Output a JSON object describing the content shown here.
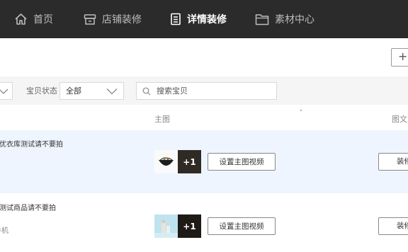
{
  "nav": {
    "items": [
      {
        "label": "首页",
        "icon": "home-icon",
        "active": false
      },
      {
        "label": "店铺装修",
        "icon": "store-icon",
        "active": false
      },
      {
        "label": "详情装修",
        "icon": "document-icon",
        "active": true
      },
      {
        "label": "素材中心",
        "icon": "folder-icon",
        "active": false
      }
    ]
  },
  "toolbar": {
    "add_label": "+"
  },
  "filters": {
    "status_label": "宝贝状态",
    "status_value": "全部",
    "search_placeholder": "搜索宝贝"
  },
  "table": {
    "headers": {
      "main_image": "主图",
      "detail": "图文"
    },
    "rows": [
      {
        "title": "优衣库测试请不要拍",
        "subtitle": "",
        "extra_count": "+1",
        "video_button": "设置主图视频",
        "decorate_button": "装修"
      },
      {
        "title": "测试商品请不要拍",
        "subtitle": "手机",
        "extra_count": "+1",
        "video_button": "设置主图视频",
        "decorate_button": "装修"
      }
    ]
  },
  "colors": {
    "nav_bg": "#2b2b2b",
    "row_highlight": "#eef5ff",
    "filter_bg": "#f5f5f5"
  }
}
